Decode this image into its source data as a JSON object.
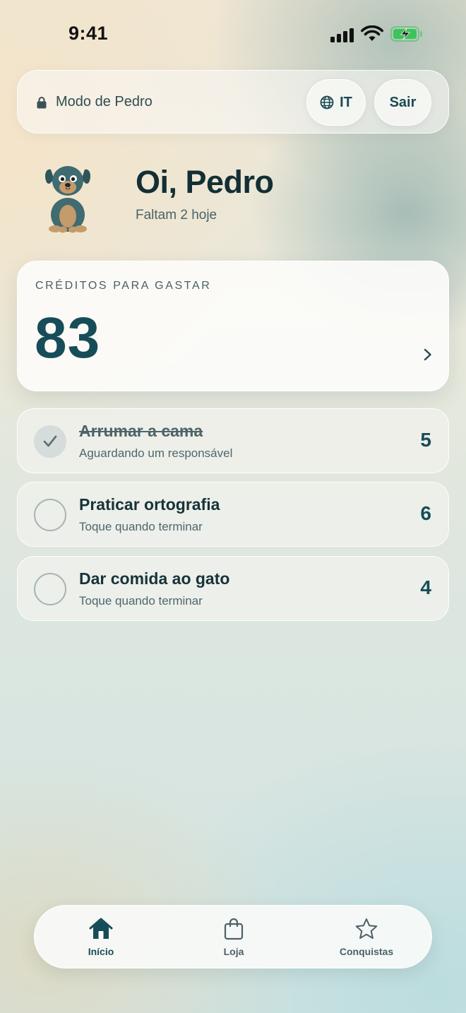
{
  "status": {
    "time": "9:41"
  },
  "header": {
    "mode_label": "Modo de Pedro",
    "lang_button": "IT",
    "exit_button": "Sair"
  },
  "profile": {
    "greeting": "Oi, Pedro",
    "subtitle": "Faltam 2 hoje"
  },
  "credits": {
    "label": "CRÉDITOS PARA GASTAR",
    "value": "83"
  },
  "tasks": [
    {
      "title": "Arrumar a cama",
      "subtitle": "Aguardando um responsável",
      "points": "5",
      "done": true
    },
    {
      "title": "Praticar ortografia",
      "subtitle": "Toque quando terminar",
      "points": "6",
      "done": false
    },
    {
      "title": "Dar comida ao gato",
      "subtitle": "Toque quando terminar",
      "points": "4",
      "done": false
    }
  ],
  "tabbar": {
    "items": [
      {
        "label": "Início",
        "icon": "home-icon",
        "active": true
      },
      {
        "label": "Loja",
        "icon": "shopping-bag-icon",
        "active": false
      },
      {
        "label": "Conquistas",
        "icon": "star-icon",
        "active": false
      }
    ]
  },
  "colors": {
    "accent": "#164d58",
    "battery": "#3cc45a"
  }
}
